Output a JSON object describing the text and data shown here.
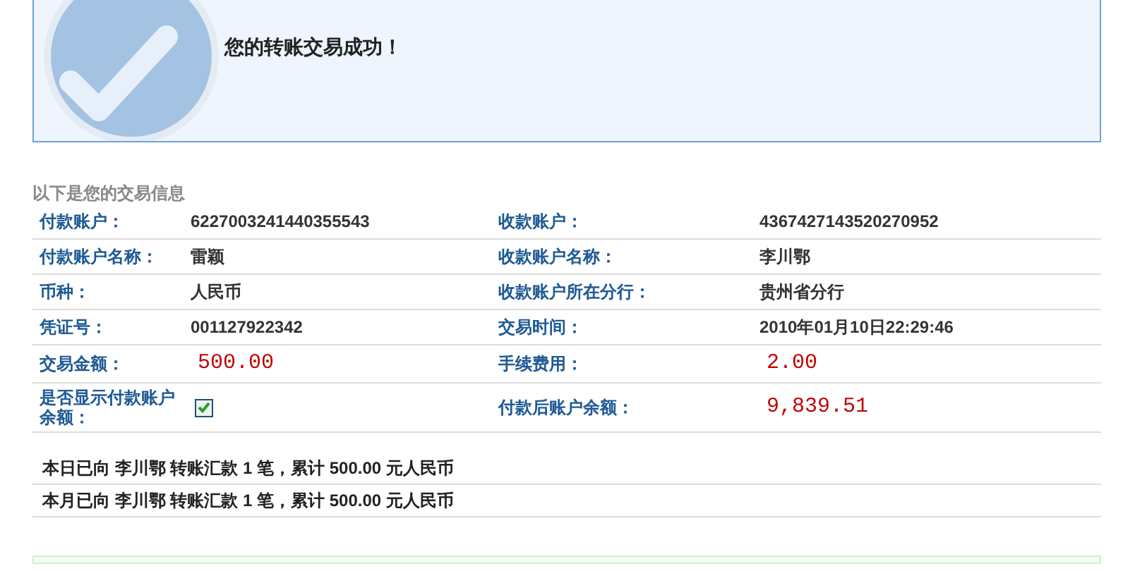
{
  "banner": {
    "message": "您的转账交易成功！"
  },
  "section_title": "以下是您的交易信息",
  "rows": [
    {
      "cells": [
        {
          "kind": "text",
          "label": "付款账户：",
          "value": "6227003241440355543"
        },
        {
          "kind": "text",
          "label": "收款账户：",
          "value": "4367427143520270952"
        }
      ]
    },
    {
      "cells": [
        {
          "kind": "text",
          "label": "付款账户名称：",
          "value": "雷颖"
        },
        {
          "kind": "text",
          "label": "收款账户名称：",
          "value": "李川鄂"
        }
      ]
    },
    {
      "cells": [
        {
          "kind": "text",
          "label": "币种：",
          "value": "人民币"
        },
        {
          "kind": "text",
          "label": "收款账户所在分行：",
          "value": "贵州省分行"
        }
      ]
    },
    {
      "cells": [
        {
          "kind": "text",
          "label": "凭证号：",
          "value": "001127922342"
        },
        {
          "kind": "text",
          "label": "交易时间：",
          "value": "2010年01月10日22:29:46"
        }
      ]
    },
    {
      "cells": [
        {
          "kind": "amount",
          "label": "交易金额：",
          "value": "500.00"
        },
        {
          "kind": "amount",
          "label": "手续费用：",
          "value": "2.00"
        }
      ]
    },
    {
      "cells": [
        {
          "kind": "checkbox",
          "label": "是否显示付款账户余额：",
          "checked": true
        },
        {
          "kind": "amount",
          "label": "付款后账户余额：",
          "value": "9,839.51"
        }
      ]
    }
  ],
  "summary": [
    "本日已向 李川鄂 转账汇款 1 笔，累计 500.00 元人民币",
    "本月已向 李川鄂 转账汇款 1 笔，累计 500.00 元人民币"
  ]
}
